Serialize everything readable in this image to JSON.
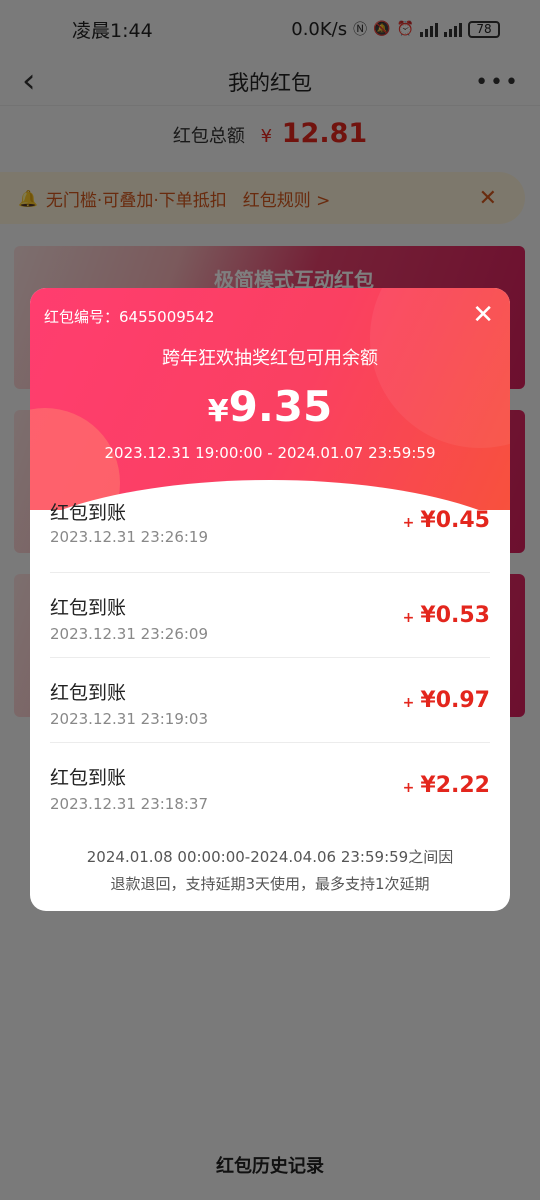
{
  "status_bar": {
    "time": "凌晨1:44",
    "network_speed": "0.0K/s",
    "battery": "78"
  },
  "header": {
    "title": "我的红包"
  },
  "total": {
    "label": "红包总额",
    "currency": "¥",
    "amount": "12.81"
  },
  "notice": {
    "text": "无门槛·可叠加·下单抵扣",
    "rules_link": "红包规则 >"
  },
  "background_cards": [
    {
      "title": "极简模式互动红包"
    }
  ],
  "history_link": "红包历史记录",
  "modal": {
    "code_label": "红包编号：6455009542",
    "title": "跨年狂欢抽奖红包可用余额",
    "currency": "¥",
    "amount": "9.35",
    "valid_range": "2023.12.31 19:00:00 - 2024.01.07 23:59:59",
    "records": [
      {
        "label": "红包到账",
        "time": "2023.12.31 23:26:19",
        "sign": "+",
        "amount": "¥0.45"
      },
      {
        "label": "红包到账",
        "time": "2023.12.31 23:26:09",
        "sign": "+",
        "amount": "¥0.53"
      },
      {
        "label": "红包到账",
        "time": "2023.12.31 23:19:03",
        "sign": "+",
        "amount": "¥0.97"
      },
      {
        "label": "红包到账",
        "time": "2023.12.31 23:18:37",
        "sign": "+",
        "amount": "¥2.22"
      }
    ],
    "footnote_line1": "2024.01.08 00:00:00-2024.04.06 23:59:59之间因",
    "footnote_line2": "退款退回，支持延期3天使用，最多支持1次延期"
  },
  "colors": {
    "accent_red": "#e3261d",
    "modal_gradient_start": "#ff3d6f",
    "modal_gradient_end": "#f8513d",
    "notice_bg": "#fbf1d8"
  }
}
